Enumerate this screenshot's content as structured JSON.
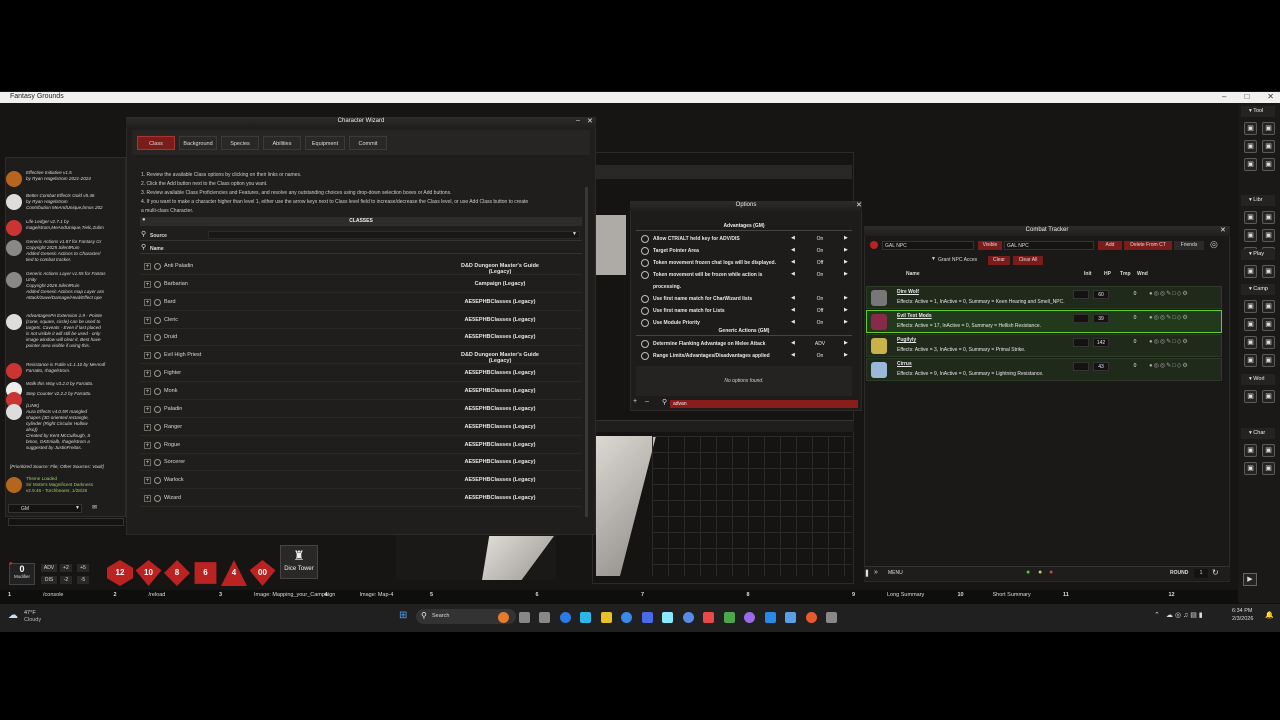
{
  "window": {
    "title": "Fantasy Grounds"
  },
  "wizard": {
    "title": "Character Wizard",
    "tabs": [
      "Class",
      "Background",
      "Species",
      "Abilities",
      "Equipment",
      "Commit"
    ],
    "instructions": [
      "1. Review the available Class options by clicking on their links or names.",
      "2. Click the Add button next to the Class option you want.",
      "3. Review available Class Proficiencies and Features, and resolve any outstanding choices using drop-down selection boxes or Add buttons.",
      "4. If you want to make a character higher than level 1, either use the arrow keys next to Class level field to increase/decrease the Class level, or use Add Class button to create",
      "a multi-class Character."
    ],
    "section": "CLASSES",
    "filter_source": "Source",
    "filter_name": "Name",
    "classes": [
      {
        "name": "Anti Paladin",
        "source": "D&D Dungeon Master's Guide (Legacy)"
      },
      {
        "name": "Barbarian",
        "source": "Campaign (Legacy)"
      },
      {
        "name": "Bard",
        "source": "AE5EPHBClasses (Legacy)"
      },
      {
        "name": "Cleric",
        "source": "AE5EPHBClasses (Legacy)"
      },
      {
        "name": "Druid",
        "source": "AE5EPHBClasses (Legacy)"
      },
      {
        "name": "Evil High Priest",
        "source": "D&D Dungeon Master's Guide (Legacy)"
      },
      {
        "name": "Fighter",
        "source": "AE5EPHBClasses (Legacy)"
      },
      {
        "name": "Monk",
        "source": "AE5EPHBClasses (Legacy)"
      },
      {
        "name": "Paladin",
        "source": "AE5EPHBClasses (Legacy)"
      },
      {
        "name": "Ranger",
        "source": "AE5EPHBClasses (Legacy)"
      },
      {
        "name": "Rogue",
        "source": "AE5EPHBClasses (Legacy)"
      },
      {
        "name": "Sorcerer",
        "source": "AE5EPHBClasses (Legacy)"
      },
      {
        "name": "Warlock",
        "source": "AE5EPHBClasses (Legacy)"
      },
      {
        "name": "Wizard",
        "source": "AE5EPHBClasses (Legacy)"
      }
    ]
  },
  "options": {
    "title": "Options",
    "group1": "Advantages (GM)",
    "items1": [
      {
        "label": "Allow CTR/ALT held key for ADV/DIS",
        "value": "On"
      },
      {
        "label": "Target Pointer Area",
        "value": "On"
      },
      {
        "label": "Token movement frozen chat logs will be displayed.",
        "value": "Off"
      },
      {
        "label": "Token movement will be frozen while action is",
        "value": "On"
      },
      {
        "label": "processing.",
        "value": ""
      },
      {
        "label": "Use first name match for CharWizard lists",
        "value": "On"
      },
      {
        "label": "Use first name match for Lists",
        "value": "Off"
      },
      {
        "label": "Use Module Priority",
        "value": "On"
      }
    ],
    "group2": "Generic Actions (GM)",
    "items2": [
      {
        "label": "Determine Flanking Advantage on Melee Attack",
        "value": "ADV"
      },
      {
        "label": "Range Limits/Advantages/Disadvantages applied",
        "value": "On"
      }
    ],
    "empty": "No options found.",
    "search": "advan"
  },
  "combat": {
    "title": "Combat Tracker",
    "faction_a": "GAL NPC",
    "visible": "Visible",
    "faction_b": "GAL NPC",
    "add": "Add",
    "delete": "Delete From CT",
    "friends": "Friends",
    "grant": "Grant NPC Acces",
    "clear": "Clear",
    "clear_all": "Clear All",
    "cols": [
      "Name",
      "Init",
      "HP",
      "Tmp",
      "Wnd"
    ],
    "rows": [
      {
        "name": "Dire Wolf",
        "effects": "Effects: Active = 1, InActive = 0,  Summary = Keen Hearing and Smell_NPC.",
        "hp": "60",
        "tmp": "0",
        "color": "#777"
      },
      {
        "name": "Evil Test Mods",
        "effects": "Effects: Active = 17, InActive = 0,  Summary = Hellish Resistance.",
        "hp": "39",
        "tmp": "0",
        "color": "#8a2a4a"
      },
      {
        "name": "Pugilyly",
        "effects": "Effects: Active = 3, InActive = 0,  Summary = Primal Strike.",
        "hp": "142",
        "tmp": "0",
        "color": "#c9b24a"
      },
      {
        "name": "Cirrus",
        "effects": "Effects: Active = 9, InActive = 0,  Summary = Lightning Resistance.",
        "hp": "43",
        "tmp": "0",
        "color": "#9bb7d9"
      }
    ],
    "menu": "MENU",
    "round_label": "ROUND",
    "round": "1"
  },
  "chat": {
    "lines": [
      "Effective Initiative v1.5\nby Ryan Hagelstrom 2021-2024",
      "Better Combat Effects Gold v5.46\nby Ryan Hagelstrom\nContribution MeAndUnique,bmos 202",
      "Life Ledger v2.7.1 by\nmagelstrom,MeAndUnique,Tielc,Zulim",
      "Generic Actions v1.87 for Fantasy Gr\nCopyright 2025 SilentRuin\nAdded Generic Actions to Character/\ntied to combat tracker.",
      "Generic Actions Layer v1.55 for Fantas\nUnity\nCopyright 2026 SilentRuin\nAdded Generic Actions map Layer ass\nAttack/Save/Damage/Heal/Effect ope",
      "AdvantagesPA Extension 1.9 - Pointe\n(cone, square, circle) can be used to\ntargets. Caveats - Even if last placed\nis not visible it will still be used - only\nimage window will clear it. Best have\npointer area visible if using this.",
      "Resistance is Futile v1.1.10 by MeAndl\nFarratto, rhagelstrom.",
      "Walk this Way v3.2.0 by Farratto.",
      "Step Counter v2.2.2 by Farratto.",
      "(LINK)\nAura Effects v4.0.5R mangled\nshapes (3D oriented rectangle,\ncylinder (Right Circular Hollow\nalso))\nCreated by Kent McCullough, S\nbmos, GKEnialb, rhagelstrom a\nsuggested by JustinFreitas.",
      "[Prioritized Source: File; Other Sources: Vault]",
      "Theme Loaded\nSir Motte's Magnificent Darkness\nv2.9.46 - Torchbearer, 1/28/26"
    ],
    "identity": "GM"
  },
  "dice": {
    "modifier": "0",
    "modifier_label": "Modifier",
    "adv": "ADV",
    "plus2": "+2",
    "plus5": "+5",
    "dis": "DIS",
    "minus2": "-2",
    "minus5": "-5",
    "labels": [
      "12",
      "10",
      "8",
      "6",
      "4",
      "00"
    ],
    "tower": "Dice Tower"
  },
  "hotkeys": [
    {
      "n": "1",
      "t": "/console"
    },
    {
      "n": "2",
      "t": "/reload"
    },
    {
      "n": "3",
      "t": "Image: Mapping_your_Campaign"
    },
    {
      "n": "4",
      "t": "Image: Map-4"
    },
    {
      "n": "5",
      "t": ""
    },
    {
      "n": "6",
      "t": ""
    },
    {
      "n": "7",
      "t": ""
    },
    {
      "n": "8",
      "t": ""
    },
    {
      "n": "9",
      "t": "Long Summary"
    },
    {
      "n": "10",
      "t": "Short Summary"
    },
    {
      "n": "11",
      "t": ""
    },
    {
      "n": "12",
      "t": ""
    }
  ],
  "sidebar": {
    "sections": [
      "Tool",
      "Libr",
      "Play",
      "Camp",
      "Worl",
      "Char"
    ]
  },
  "taskbar": {
    "temp": "47°F",
    "weather": "Cloudy",
    "search": "Search",
    "time": "6:34 PM",
    "date": "2/3/2026"
  },
  "colors": {
    "accent": "#7a1d1a",
    "green": "#3c7a2c"
  }
}
